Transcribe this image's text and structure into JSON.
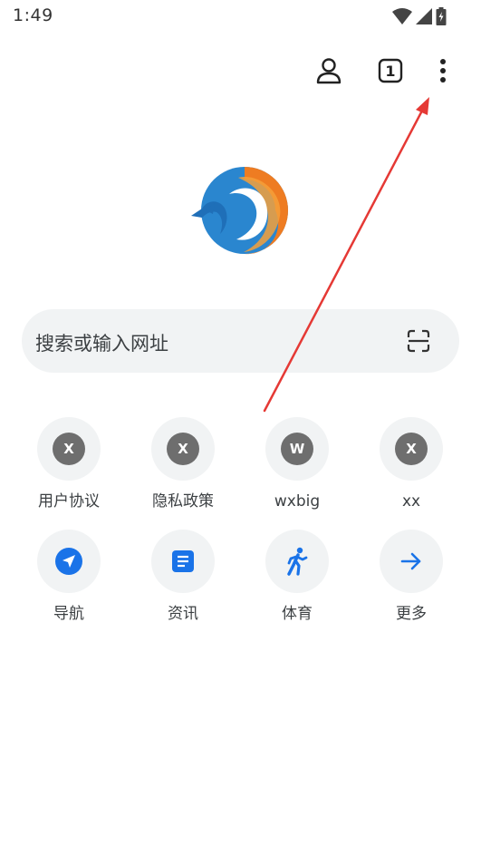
{
  "status": {
    "time": "1:49"
  },
  "toolbar": {
    "tab_count": "1"
  },
  "search": {
    "placeholder": "搜索或输入网址"
  },
  "shortcuts_row1": [
    {
      "badge": "X",
      "label": "用户协议"
    },
    {
      "badge": "X",
      "label": "隐私政策"
    },
    {
      "badge": "W",
      "label": "wxbig"
    },
    {
      "badge": "X",
      "label": "xx"
    }
  ],
  "shortcuts_row2": [
    {
      "icon": "navigation-icon",
      "label": "导航"
    },
    {
      "icon": "news-icon",
      "label": "资讯"
    },
    {
      "icon": "sports-icon",
      "label": "体育"
    },
    {
      "icon": "arrow-right-icon",
      "label": "更多"
    }
  ],
  "colors": {
    "accent_blue": "#1a73e8",
    "search_bg": "#f1f3f4",
    "badge_gray": "#6e6e6e",
    "annotation_red": "#e53935"
  }
}
